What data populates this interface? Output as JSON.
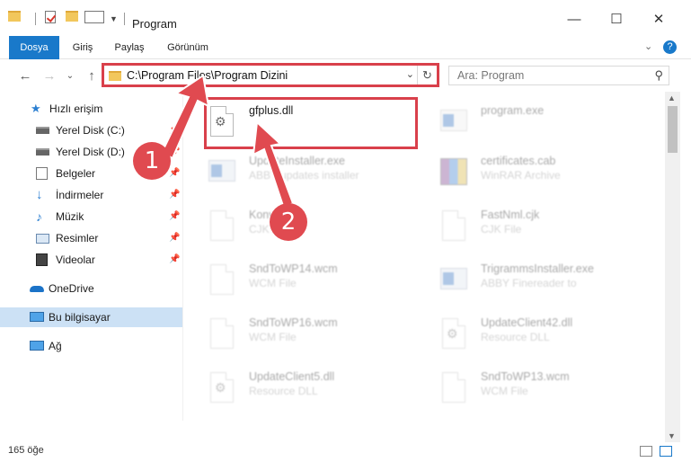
{
  "window": {
    "title": "Program"
  },
  "ribbon": {
    "tabs": [
      "Dosya",
      "Giriş",
      "Paylaş",
      "Görünüm"
    ]
  },
  "nav": {
    "address": "C:\\Program Files\\Program Dizini",
    "search_placeholder": "Ara: Program"
  },
  "sidebar": {
    "quick_access": "Hızlı erişim",
    "items": [
      "Yerel Disk (C:)",
      "Yerel Disk (D:)",
      "Belgeler",
      "İndirmeler",
      "Müzik",
      "Resimler",
      "Videolar"
    ],
    "onedrive": "OneDrive",
    "this_pc": "Bu bilgisayar",
    "network": "Ağ"
  },
  "files": [
    {
      "name": "gfplus.dll",
      "type": ""
    },
    {
      "name": "program.exe",
      "type": ""
    },
    {
      "name": "UpdateInstaller.exe",
      "type": "ABBY updates installer"
    },
    {
      "name": "certificates.cab",
      "type": "WinRAR Archive"
    },
    {
      "name": "Konv",
      "type": "CJK File"
    },
    {
      "name": "FastNml.cjk",
      "type": "CJK File"
    },
    {
      "name": "SndToWP14.wcm",
      "type": "WCM File"
    },
    {
      "name": "TrigrammsInstaller.exe",
      "type": "ABBY Finereader to"
    },
    {
      "name": "SndToWP16.wcm",
      "type": "WCM File"
    },
    {
      "name": "UpdateClient42.dll",
      "type": "Resource DLL"
    },
    {
      "name": "UpdateClient5.dll",
      "type": "Resource DLL"
    },
    {
      "name": "SndToWP13.wcm",
      "type": "WCM File"
    }
  ],
  "status": {
    "count": "165 öğe"
  },
  "annotations": {
    "step1": "1",
    "step2": "2"
  },
  "colors": {
    "accent": "#1979ca",
    "highlight": "#d9404b",
    "selected": "#cce1f5"
  }
}
